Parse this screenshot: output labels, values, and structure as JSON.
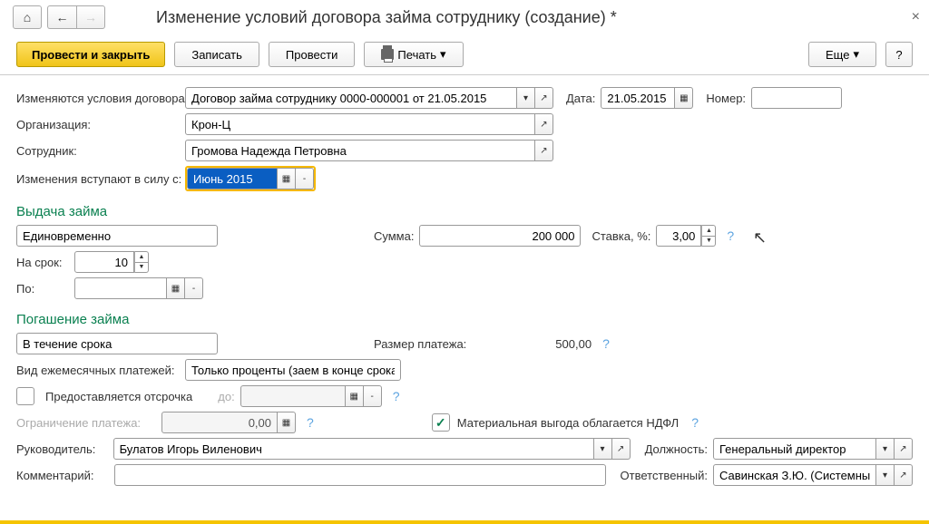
{
  "title": "Изменение условий договора займа сотруднику (создание) *",
  "toolbar": {
    "post_close": "Провести и закрыть",
    "write": "Записать",
    "post": "Провести",
    "print": "Печать",
    "more": "Еще",
    "help": "?"
  },
  "fields": {
    "contract_label": "Изменяются условия договора:",
    "contract_value": "Договор займа сотруднику 0000-000001 от 21.05.2015",
    "date_label": "Дата:",
    "date_value": "21.05.2015",
    "number_label": "Номер:",
    "number_value": "",
    "org_label": "Организация:",
    "org_value": "Крон-Ц",
    "emp_label": "Сотрудник:",
    "emp_value": "Громова Надежда Петровна",
    "effective_label": "Изменения вступают в силу с:",
    "effective_value": "Июнь 2015"
  },
  "loan_issue": {
    "section": "Выдача займа",
    "type_value": "Единовременно",
    "amount_label": "Сумма:",
    "amount_value": "200 000",
    "rate_label": "Ставка, %:",
    "rate_value": "3,00",
    "term_label": "На срок:",
    "term_value": "10",
    "until_label": "По:",
    "until_value": ""
  },
  "repayment": {
    "section": "Погашение займа",
    "type_value": "В течение срока",
    "payment_label": "Размер платежа:",
    "payment_value": "500,00",
    "monthly_label": "Вид ежемесячных платежей:",
    "monthly_value": "Только проценты (заем в конце срока)",
    "defer_label": "Предоставляется отсрочка",
    "defer_until": "до:",
    "limit_label": "Ограничение платежа:",
    "limit_value": "0,00",
    "ndfl_label": "Материальная выгода облагается НДФЛ"
  },
  "footer": {
    "manager_label": "Руководитель:",
    "manager_value": "Булатов Игорь Виленович",
    "position_label": "Должность:",
    "position_value": "Генеральный директор",
    "comment_label": "Комментарий:",
    "comment_value": "",
    "responsible_label": "Ответственный:",
    "responsible_value": "Савинская З.Ю. (Системный прог"
  }
}
